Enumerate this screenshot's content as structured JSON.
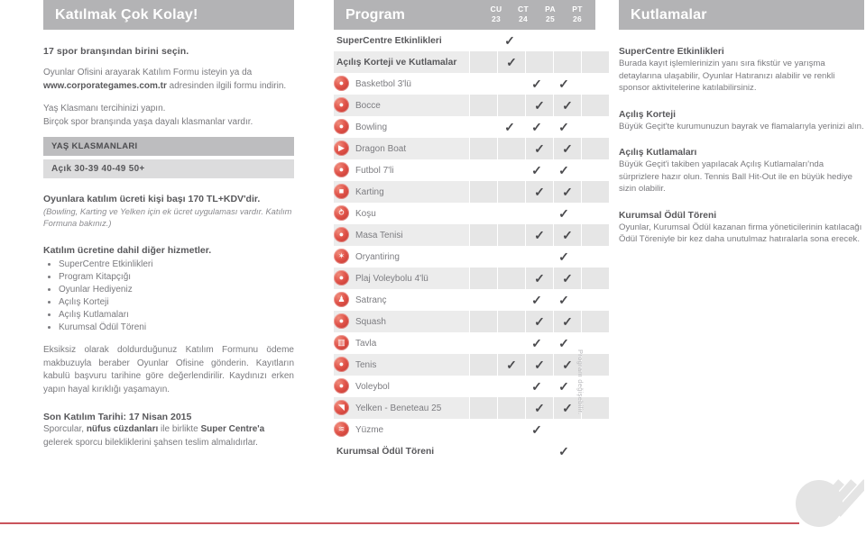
{
  "left": {
    "title": "Katılmak Çok Kolay!",
    "lead": "17 spor branşından birini seçin.",
    "para1_a": "Oyunlar Ofisini arayarak Katılım Formu isteyin ya da ",
    "para1_b": "www.corporategames.com.tr",
    "para1_c": " adresinden ilgili formu indirin.",
    "para2_a": "Yaş Klasmanı tercihinizi yapın.",
    "para2_b": "Birçok spor branşında yaşa dayalı klasmanlar vardır.",
    "age_header": "YAŞ KLASMANLARI",
    "age_values": "Açık 30-39 40-49 50+",
    "fee_title": "Oyunlara katılım ücreti kişi başı 170 TL+KDV'dir.",
    "fee_note": "(Bowling, Karting ve Yelken için ek ücret uygulaması vardır. Katılım Formuna bakınız.)",
    "services_title": "Katılım ücretine dahil diğer hizmetler.",
    "services": [
      "SuperCentre Etkinlikleri",
      "Program Kitapçığı",
      "Oyunlar Hediyeniz",
      "Açılış Korteji",
      "Açılış Kutlamaları",
      "Kurumsal Ödül Töreni"
    ],
    "para3": "Eksiksiz olarak doldurduğunuz Katılım Formunu ödeme makbuzuyla beraber Oyunlar Ofisine gönderin. Kayıtların kabulü başvuru tarihine göre değerlendirilir. Kaydınızı erken yapın hayal kırıklığı yaşamayın.",
    "deadline_title": "Son Katılım Tarihi: 17 Nisan 2015",
    "deadline_a": "Sporcular, ",
    "deadline_b": "nüfus cüzdanları",
    "deadline_c": " ile birlikte ",
    "deadline_d": "Super Centre'a",
    "deadline_e": " gelerek sporcu bilekliklerini şahsen teslim almalıdırlar."
  },
  "program": {
    "title": "Program",
    "note_vertical": "Program değişebilir.",
    "days": [
      {
        "name": "CU",
        "date": "23"
      },
      {
        "name": "CT",
        "date": "24"
      },
      {
        "name": "PA",
        "date": "25"
      },
      {
        "name": "PT",
        "date": "26"
      }
    ],
    "rows": [
      {
        "label": "SuperCentre Etkinlikleri",
        "icon": "",
        "bold": true,
        "alt": false,
        "checks": [
          1,
          0,
          0,
          0
        ]
      },
      {
        "label": "Açılış Korteji ve Kutlamalar",
        "icon": "",
        "bold": true,
        "alt": true,
        "checks": [
          1,
          0,
          0,
          0
        ]
      },
      {
        "label": "Basketbol 3'lü",
        "icon": "basketball-icon",
        "bold": false,
        "alt": false,
        "checks": [
          0,
          1,
          1,
          0
        ]
      },
      {
        "label": "Bocce",
        "icon": "bocce-icon",
        "bold": false,
        "alt": true,
        "checks": [
          0,
          1,
          1,
          0
        ]
      },
      {
        "label": "Bowling",
        "icon": "bowling-icon",
        "bold": false,
        "alt": false,
        "checks": [
          1,
          1,
          1,
          0
        ]
      },
      {
        "label": "Dragon Boat",
        "icon": "dragonboat-icon",
        "bold": false,
        "alt": true,
        "checks": [
          0,
          1,
          1,
          0
        ]
      },
      {
        "label": "Futbol 7'li",
        "icon": "football-icon",
        "bold": false,
        "alt": false,
        "checks": [
          0,
          1,
          1,
          0
        ]
      },
      {
        "label": "Karting",
        "icon": "karting-icon",
        "bold": false,
        "alt": true,
        "checks": [
          0,
          1,
          1,
          0
        ]
      },
      {
        "label": "Koşu",
        "icon": "running-icon",
        "bold": false,
        "alt": false,
        "checks": [
          0,
          0,
          1,
          0
        ]
      },
      {
        "label": "Masa Tenisi",
        "icon": "tabletennis-icon",
        "bold": false,
        "alt": true,
        "checks": [
          0,
          1,
          1,
          0
        ]
      },
      {
        "label": "Oryantiring",
        "icon": "orienteering-icon",
        "bold": false,
        "alt": false,
        "checks": [
          0,
          0,
          1,
          0
        ]
      },
      {
        "label": "Plaj Voleybolu 4'lü",
        "icon": "beachvolley-icon",
        "bold": false,
        "alt": true,
        "checks": [
          0,
          1,
          1,
          0
        ]
      },
      {
        "label": "Satranç",
        "icon": "chess-icon",
        "bold": false,
        "alt": false,
        "checks": [
          0,
          1,
          1,
          0
        ]
      },
      {
        "label": "Squash",
        "icon": "squash-icon",
        "bold": false,
        "alt": true,
        "checks": [
          0,
          1,
          1,
          0
        ]
      },
      {
        "label": "Tavla",
        "icon": "backgammon-icon",
        "bold": false,
        "alt": false,
        "checks": [
          0,
          1,
          1,
          0
        ]
      },
      {
        "label": "Tenis",
        "icon": "tennis-icon",
        "bold": false,
        "alt": true,
        "checks": [
          1,
          1,
          1,
          0
        ]
      },
      {
        "label": "Voleybol",
        "icon": "volleyball-icon",
        "bold": false,
        "alt": false,
        "checks": [
          0,
          1,
          1,
          0
        ]
      },
      {
        "label": "Yelken - Beneteau 25",
        "icon": "sailing-icon",
        "bold": false,
        "alt": true,
        "checks": [
          0,
          1,
          1,
          0
        ]
      },
      {
        "label": "Yüzme",
        "icon": "swimming-icon",
        "bold": false,
        "alt": false,
        "checks": [
          0,
          1,
          0,
          0
        ]
      },
      {
        "label": "Kurumsal Ödül Töreni",
        "icon": "",
        "bold": true,
        "alt": false,
        "checks": [
          0,
          0,
          1,
          0
        ]
      }
    ]
  },
  "right": {
    "title": "Kutlamalar",
    "sections": [
      {
        "heading": "SuperCentre Etkinlikleri",
        "body": "Burada kayıt işlemlerinizin yanı sıra fikstür ve yarışma detaylarına ulaşabilir, Oyunlar Hatıranızı alabilir ve renkli sponsor aktivitelerine katılabilirsiniz."
      },
      {
        "heading": "Açılış Korteji",
        "body": "Büyük Geçit'te kurumunuzun bayrak ve flamalarıyla yerinizi alın."
      },
      {
        "heading": "Açılış Kutlamaları",
        "body": "Büyük Geçit'i takiben yapılacak Açılış Kutlamaları'nda sürprizlere hazır olun. Tennis Ball Hit-Out ile en büyük hediye sizin olabilir."
      },
      {
        "heading": "Kurumsal Ödül Töreni",
        "body": "Oyunlar, Kurumsal Ödül kazanan firma yöneticilerinin katılacağı Ödül Töreniyle bir kez daha unutulmaz hatıralarla sona erecek."
      }
    ]
  },
  "colors": {
    "header_gray": "#b3b3b5",
    "accent_red": "#c9535c",
    "icon_red": "#d8483f",
    "row_alt": "#ececec"
  },
  "icon_glyphs": {
    "basketball-icon": "●",
    "bocce-icon": "●",
    "bowling-icon": "●",
    "dragonboat-icon": "▶",
    "football-icon": "●",
    "karting-icon": "■",
    "running-icon": "⥁",
    "tabletennis-icon": "●",
    "orienteering-icon": "✶",
    "beachvolley-icon": "●",
    "chess-icon": "♟",
    "squash-icon": "●",
    "backgammon-icon": "▥",
    "tennis-icon": "●",
    "volleyball-icon": "●",
    "sailing-icon": "◥",
    "swimming-icon": "≋"
  },
  "check_glyph": "✓"
}
